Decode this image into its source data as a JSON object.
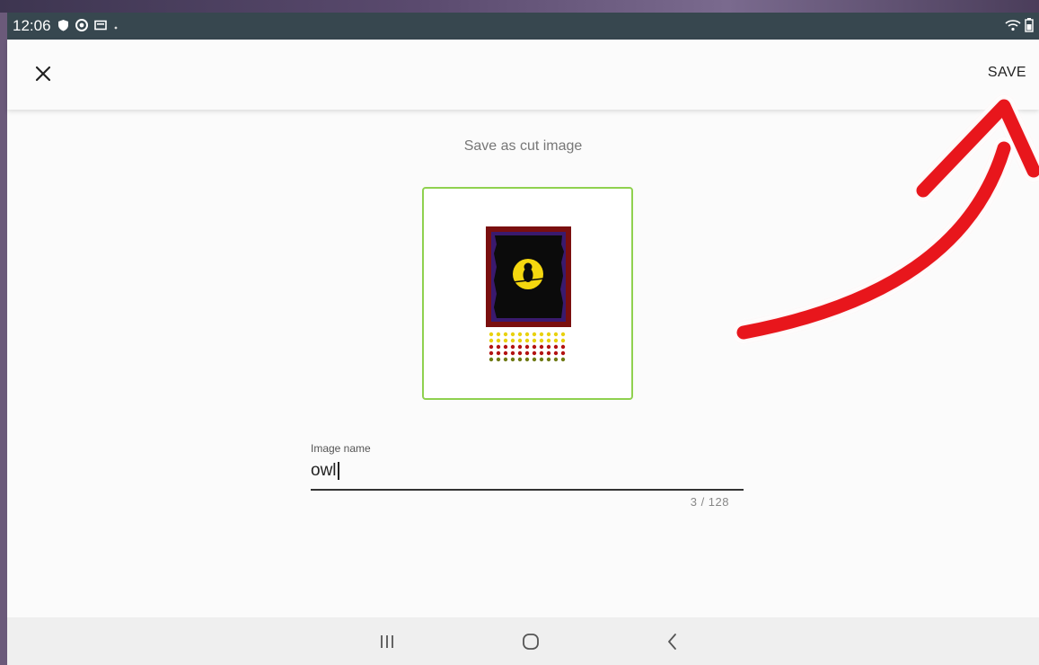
{
  "status_bar": {
    "time": "12:06",
    "icons": [
      "shield-icon",
      "at-sign-icon",
      "card-icon",
      "dot-icon"
    ],
    "right_icons": [
      "wifi-icon",
      "battery-icon"
    ]
  },
  "app_bar": {
    "close_icon": "close-icon",
    "save_label": "SAVE"
  },
  "main": {
    "heading": "Save as cut image",
    "preview": {
      "border_color": "#8fd14f",
      "image": "owl-on-moon-frame-with-dot-rows"
    },
    "name_field": {
      "label": "Image name",
      "value": "owl",
      "counter": "3 / 128"
    }
  },
  "nav_bar": {
    "buttons": [
      "recents-icon",
      "home-icon",
      "back-icon"
    ]
  },
  "annotation": {
    "arrow_color": "#e8121a"
  }
}
